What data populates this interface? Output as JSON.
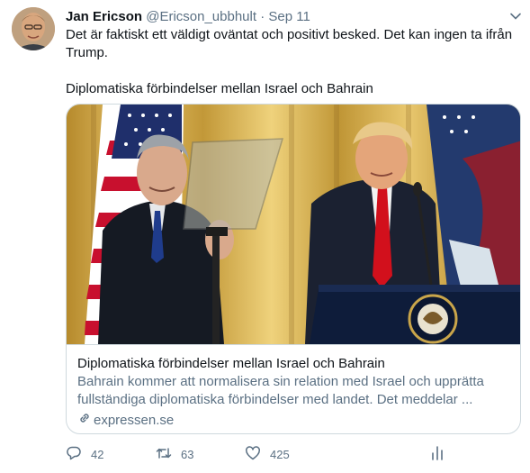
{
  "tweet": {
    "author_name": "Jan Ericson",
    "author_handle": "@Ericson_ubbhult",
    "separator": "·",
    "date": "Sep 11",
    "text": "Det är faktiskt ett väldigt oväntat och positivt besked. Det kan ingen ta ifrån Trump.\n\nDiplomatiska förbindelser mellan Israel och Bahrain"
  },
  "card": {
    "title": "Diplomatiska förbindelser mellan Israel och Bahrain",
    "description": "Bahrain kommer att normalisera sin relation med Israel och upprätta fullständiga diplomatiska förbindelser med landet. Det meddelar ...",
    "domain": "expressen.se"
  },
  "actions": {
    "reply_count": "42",
    "retweet_count": "63",
    "like_count": "425"
  },
  "colors": {
    "text": "#0f1419",
    "secondary": "#5b7083",
    "border": "#cfd9de"
  },
  "icons": [
    "chevron-down-icon",
    "link-icon",
    "reply-icon",
    "retweet-icon",
    "like-icon",
    "analytics-icon"
  ]
}
